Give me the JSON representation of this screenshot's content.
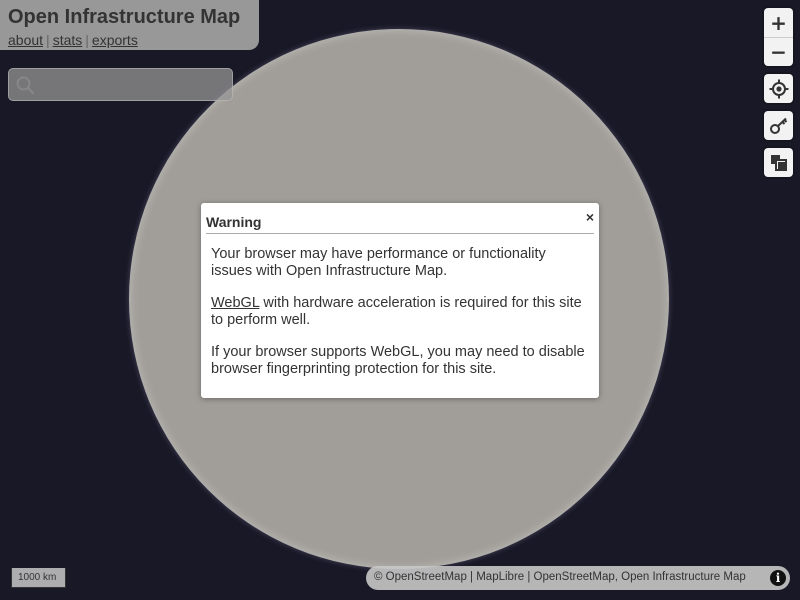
{
  "header": {
    "title": "Open Infrastructure Map",
    "links": [
      {
        "label": "about"
      },
      {
        "label": "stats"
      },
      {
        "label": "exports"
      }
    ],
    "separator": "|"
  },
  "search": {
    "placeholder": "",
    "value": ""
  },
  "controls": {
    "zoom_in": "+",
    "zoom_out": "−",
    "icons": [
      "zoom-in-icon",
      "zoom-out-icon",
      "locate-icon",
      "key-icon",
      "layers-icon"
    ]
  },
  "dialog": {
    "title": "Warning",
    "close": "×",
    "p1": "Your browser may have performance or functionality issues with Open Infrastructure Map.",
    "p2_link": "WebGL",
    "p2_rest": " with hardware acceleration is required for this site to perform well.",
    "p3": "If your browser supports WebGL, you may need to disable browser fingerprinting protection for this site."
  },
  "scale": {
    "label": "1000 km"
  },
  "attribution": {
    "text": "© OpenStreetMap | MapLibre | OpenStreetMap, Open Infrastructure Map",
    "info": "i"
  },
  "colors": {
    "background": "#181826",
    "globe": "#a19e99",
    "panel": "#aaaaaa"
  }
}
